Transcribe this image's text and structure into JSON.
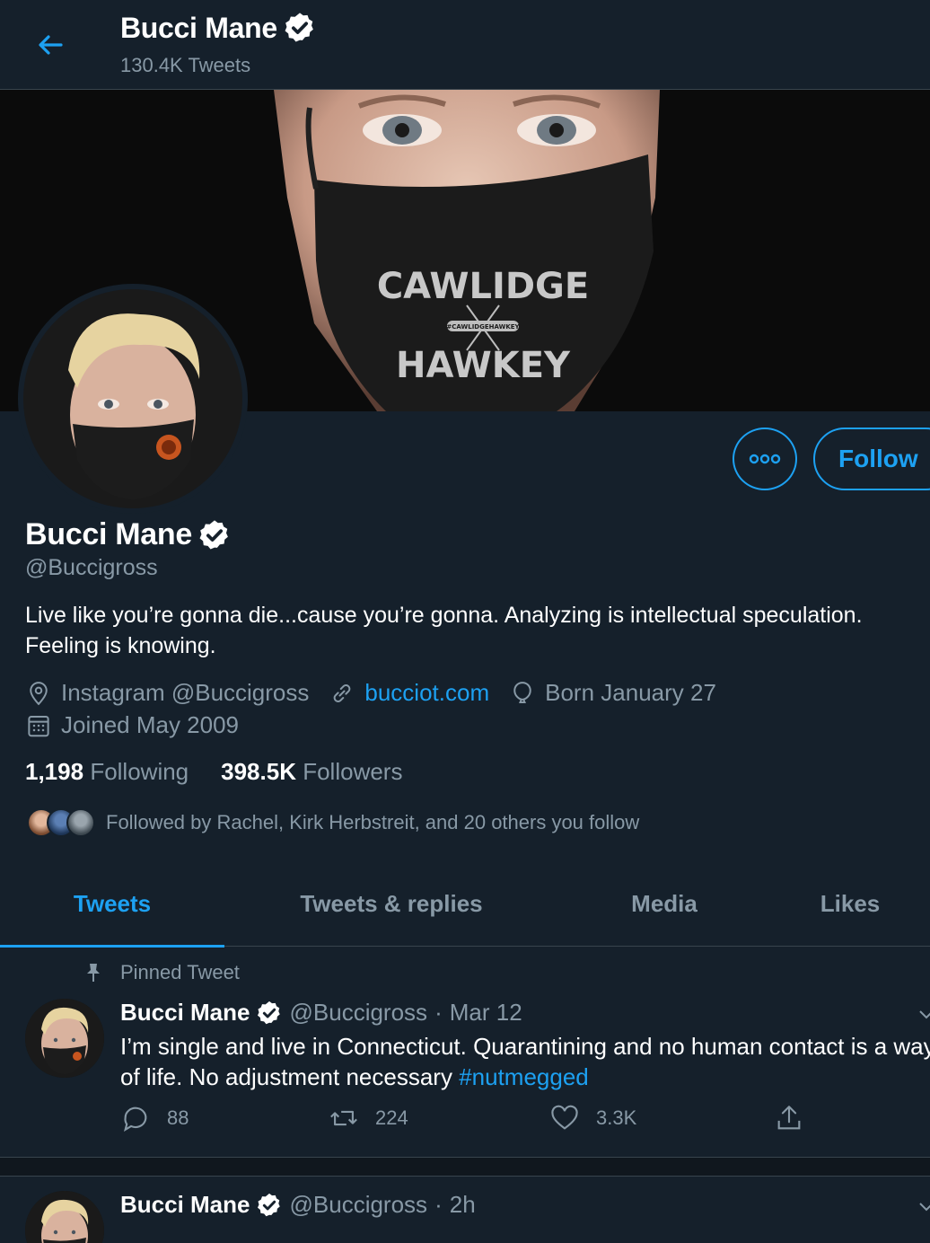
{
  "header": {
    "name": "Bucci Mane",
    "tweet_count": "130.4K Tweets"
  },
  "banner": {
    "mask_text_top": "CAWLIDGE",
    "mask_text_mid": "#CAWLIDGEHAWKEY",
    "mask_text_bottom": "HAWKEY"
  },
  "profile": {
    "name": "Bucci Mane",
    "handle": "@Buccigross",
    "bio": "Live like you’re gonna die...cause you’re gonna. Analyzing is intellectual speculation. Feeling is knowing.",
    "location": "Instagram @Buccigross",
    "website": "bucciot.com",
    "birthday": "Born January 27",
    "joined": "Joined May 2009",
    "following_count": "1,198",
    "following_label": "Following",
    "followers_count": "398.5K",
    "followers_label": "Followers",
    "followed_by": "Followed by Rachel, Kirk Herbstreit, and 20 others you follow",
    "follow_label": "Follow"
  },
  "tabs": [
    {
      "label": "Tweets",
      "active": true
    },
    {
      "label": "Tweets & replies",
      "active": false
    },
    {
      "label": "Media",
      "active": false
    },
    {
      "label": "Likes",
      "active": false
    }
  ],
  "tweets": [
    {
      "pinned_label": "Pinned Tweet",
      "name": "Bucci Mane",
      "handle": "@Buccigross",
      "date": "Mar 12",
      "text": "I’m single and live in Connecticut. Quarantining and no human contact is a way of life. No adjustment necessary ",
      "hashtag": "#nutmegged",
      "replies": "88",
      "retweets": "224",
      "likes": "3.3K"
    },
    {
      "name": "Bucci Mane",
      "handle": "@Buccigross",
      "date": "2h"
    }
  ],
  "colors": {
    "background": "#15202b",
    "accent": "#1da1f2",
    "secondary_text": "#8899a6",
    "border": "#38444d"
  }
}
